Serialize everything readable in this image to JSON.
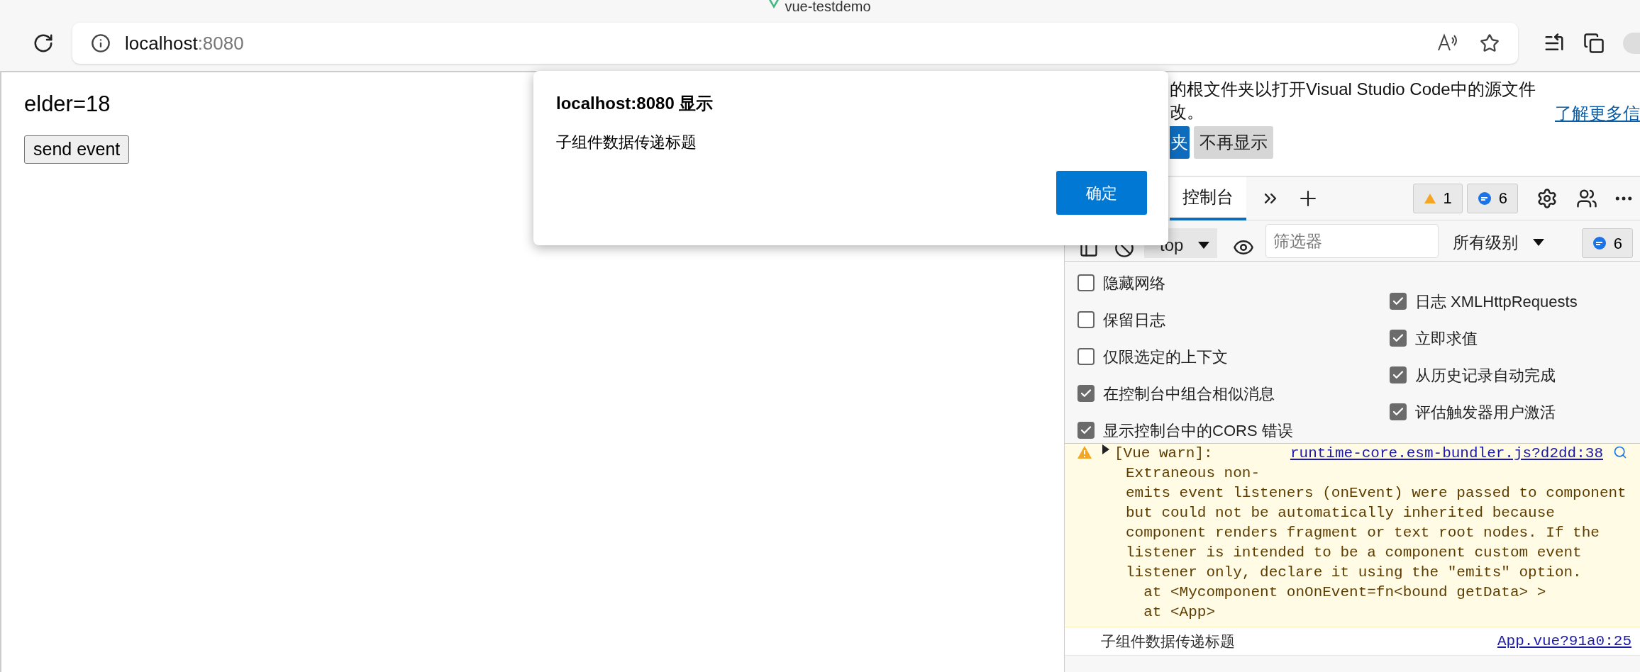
{
  "tab": {
    "title": "vue-testdemo"
  },
  "address_bar": {
    "host": "localhost",
    "port": ":8080"
  },
  "page": {
    "text": "elder=18",
    "button": "send event"
  },
  "dialog": {
    "title": "localhost:8080 显示",
    "message": "子组件数据传递标题",
    "ok": "确定"
  },
  "devtools": {
    "notice": {
      "lines": [
        "的根文件夹以打开Visual Studio Code中的源文件",
        "改。"
      ],
      "primary": "夹",
      "dismiss": "不再显示",
      "link": "了解更多信"
    },
    "tabs": [
      {
        "label": "控制台",
        "selected": true
      }
    ],
    "warnings": "1",
    "messages": "6",
    "toolbar": {
      "context": "top",
      "filter_placeholder": "筛选器",
      "levels": "所有级别",
      "count": "6"
    },
    "settings_left": [
      {
        "label": "隐藏网络",
        "checked": false
      },
      {
        "label": "保留日志",
        "checked": false
      },
      {
        "label": "仅限选定的上下文",
        "checked": false
      },
      {
        "label": "在控制台中组合相似消息",
        "checked": true
      },
      {
        "label": "显示控制台中的CORS 错误",
        "checked": true
      }
    ],
    "settings_right": [
      {
        "label": "日志 XMLHttpRequests",
        "checked": true
      },
      {
        "label": "立即求值",
        "checked": true
      },
      {
        "label": "从历史记录自动完成",
        "checked": true
      },
      {
        "label": "评估触发器用户激活",
        "checked": true
      }
    ],
    "console": [
      {
        "kind": "warning",
        "head": "[Vue warn]:",
        "source": "runtime-core.esm-bundler.js?d2dd:38",
        "lines": [
          "Extraneous non-",
          "emits event listeners (onEvent) were passed to component",
          "but could not be automatically inherited because",
          "component renders fragment or text root nodes. If the",
          "listener is intended to be a component custom event",
          "listener only, declare it using the \"emits\" option.",
          "  at <Mycomponent onOnEvent=fn<bound getData> >",
          "  at <App>"
        ]
      },
      {
        "kind": "log",
        "text": "子组件数据传递标题",
        "source": "App.vue?91a0:25"
      }
    ]
  }
}
